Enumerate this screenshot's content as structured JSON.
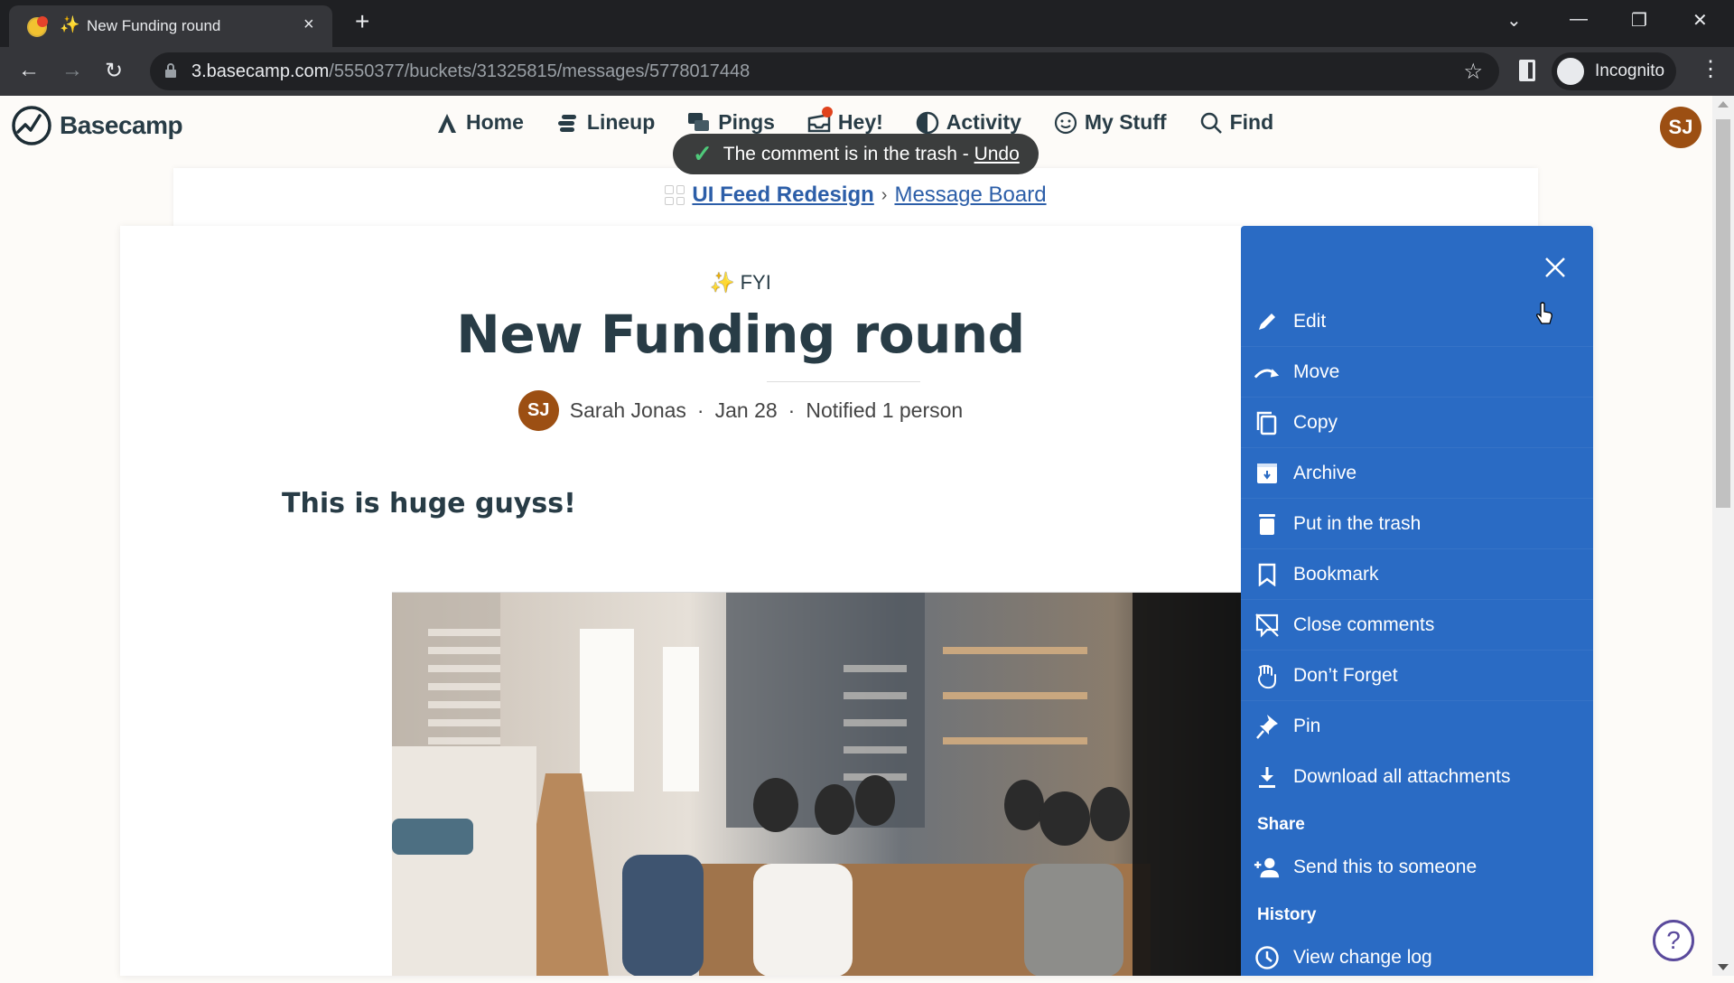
{
  "browser": {
    "tab_title": "New Funding round",
    "tab_emoji": "✨",
    "new_tab": "+",
    "close_tab": "×",
    "url_host": "3.basecamp.com",
    "url_path": "/5550377/buckets/31325815/messages/5778017448",
    "profile_label": "Incognito"
  },
  "app": {
    "logo_text": "Basecamp",
    "nav": [
      {
        "label": "Home",
        "icon": "home-icon"
      },
      {
        "label": "Lineup",
        "icon": "lineup-icon"
      },
      {
        "label": "Pings",
        "icon": "pings-icon"
      },
      {
        "label": "Hey!",
        "icon": "hey-icon"
      },
      {
        "label": "Activity",
        "icon": "activity-icon"
      },
      {
        "label": "My Stuff",
        "icon": "my-stuff-icon"
      },
      {
        "label": "Find",
        "icon": "search-icon"
      }
    ],
    "user_initials": "SJ",
    "user_avatar_color": "#9c4f13"
  },
  "toast": {
    "message": "The comment is in the trash - ",
    "action": "Undo"
  },
  "breadcrumb": {
    "project": "UI Feed Redesign",
    "separator": "›",
    "section": "Message Board"
  },
  "message": {
    "category": "FYI",
    "category_emoji": "✨",
    "title": "New Funding round",
    "author_initials": "SJ",
    "author": "Sarah Jonas",
    "date": "Jan 28",
    "notified": "Notified 1 person",
    "dot": "·",
    "body": "This is huge guyss!"
  },
  "panel": {
    "color": "#2a6bc4",
    "items": [
      {
        "label": "Edit",
        "icon": "pencil-icon"
      },
      {
        "label": "Move",
        "icon": "move-arrow-icon"
      },
      {
        "label": "Copy",
        "icon": "copy-icon"
      },
      {
        "label": "Archive",
        "icon": "archive-icon"
      },
      {
        "label": "Put in the trash",
        "icon": "trash-icon"
      },
      {
        "label": "Bookmark",
        "icon": "bookmark-icon"
      },
      {
        "label": "Close comments",
        "icon": "close-comments-icon"
      },
      {
        "label": "Don’t Forget",
        "icon": "dont-forget-icon"
      },
      {
        "label": "Pin",
        "icon": "pin-icon"
      },
      {
        "label": "Download all attachments",
        "icon": "download-icon"
      }
    ],
    "share_heading": "Share",
    "share_items": [
      {
        "label": "Send this to someone",
        "icon": "add-person-icon"
      }
    ],
    "history_heading": "History",
    "history_items": [
      {
        "label": "View change log",
        "icon": "clock-icon"
      }
    ]
  },
  "help": "?"
}
